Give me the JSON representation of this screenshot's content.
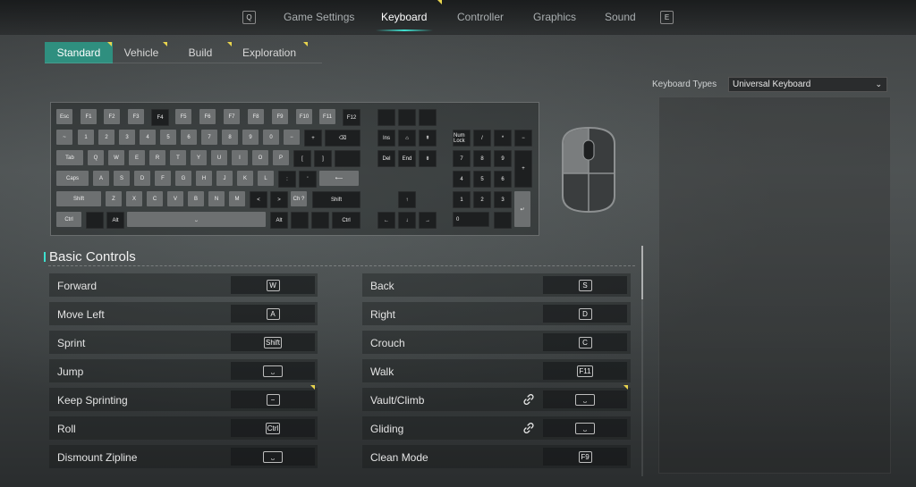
{
  "top_nav": {
    "left_key": "Q",
    "right_key": "E",
    "tabs": [
      {
        "label": "Game Settings"
      },
      {
        "label": "Keyboard"
      },
      {
        "label": "Controller"
      },
      {
        "label": "Graphics"
      },
      {
        "label": "Sound"
      }
    ],
    "active_tab": "Keyboard"
  },
  "sub_tabs": [
    {
      "label": "Standard"
    },
    {
      "label": "Vehicle"
    },
    {
      "label": "Build"
    },
    {
      "label": "Exploration"
    }
  ],
  "keyboard_types": {
    "label": "Keyboard Types",
    "value": "Universal Keyboard"
  },
  "keyboard_keys": {
    "fn_row": [
      "Esc",
      "F1",
      "F2",
      "F3",
      "F4",
      "F5",
      "F6",
      "F7",
      "F8",
      "F9",
      "F10",
      "F11",
      "F12"
    ],
    "num_row": [
      "~",
      "1",
      "2",
      "3",
      "4",
      "5",
      "6",
      "7",
      "8",
      "9",
      "0",
      "−",
      "+",
      "⌫"
    ],
    "q_row": [
      "Tab",
      "Q",
      "W",
      "E",
      "R",
      "T",
      "Y",
      "U",
      "I",
      "O",
      "P",
      "[",
      "]"
    ],
    "a_row": [
      "Caps",
      "A",
      "S",
      "D",
      "F",
      "G",
      "H",
      "J",
      "K",
      "L",
      ":",
      "'",
      "⟵"
    ],
    "z_row": [
      "Shift",
      "Z",
      "X",
      "C",
      "V",
      "B",
      "N",
      "M",
      "<",
      ">",
      "Ch ?",
      "Shift"
    ],
    "bottom_row": [
      "Ctrl",
      "Alt",
      "⎵",
      "Alt",
      "Ctrl"
    ],
    "nav_keys": [
      "Ins",
      "⌂",
      "⇞",
      "Del",
      "End",
      "⇟"
    ],
    "arrows": [
      "↑",
      "←",
      "↓",
      "→"
    ],
    "numpad_top": [
      "Num Lock",
      "/",
      "*",
      "−"
    ],
    "numpad": [
      "7",
      "8",
      "9",
      "+",
      "4",
      "5",
      "6",
      "1",
      "2",
      "3",
      "↵",
      "0"
    ]
  },
  "basic_controls": {
    "title": "Basic Controls",
    "left": [
      {
        "label": "Forward",
        "key": "W"
      },
      {
        "label": "Move Left",
        "key": "A"
      },
      {
        "label": "Sprint",
        "key": "Shift"
      },
      {
        "label": "Jump",
        "key": "⎵"
      },
      {
        "label": "Keep Sprinting",
        "key": "−"
      },
      {
        "label": "Roll",
        "key": "Ctrl"
      },
      {
        "label": "Dismount Zipline",
        "key": "⎵"
      }
    ],
    "right": [
      {
        "label": "Back",
        "key": "S"
      },
      {
        "label": "Right",
        "key": "D"
      },
      {
        "label": "Crouch",
        "key": "C"
      },
      {
        "label": "Walk",
        "key": "F11"
      },
      {
        "label": "Vault/Climb",
        "key": "⎵"
      },
      {
        "label": "Gliding",
        "key": "⎵"
      },
      {
        "label": "Clean Mode",
        "key": "F9"
      }
    ]
  },
  "colors": {
    "accent": "#3ee0cf",
    "active_subtab": "#2f8f7f",
    "modified_marker": "#e8d44d"
  }
}
